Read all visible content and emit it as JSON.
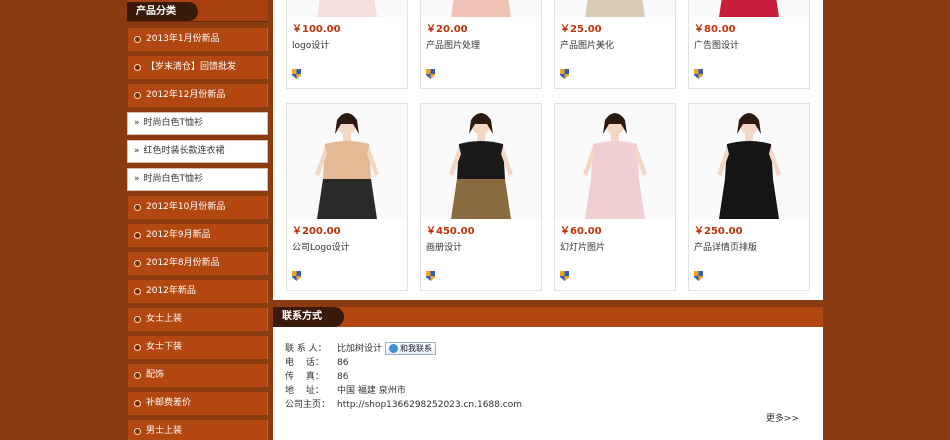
{
  "sidebar": {
    "title": "产品分类",
    "items": [
      {
        "label": "2013年1月份新品",
        "type": "main"
      },
      {
        "label": "【岁末清仓】回馈批发",
        "type": "main"
      },
      {
        "label": "2012年12月份新品",
        "type": "main"
      },
      {
        "label": "时尚白色T恤衫",
        "type": "sub"
      },
      {
        "label": "红色时装长款连衣裙",
        "type": "sub"
      },
      {
        "label": "时尚白色T恤衫",
        "type": "sub"
      },
      {
        "label": "2012年10月份新品",
        "type": "main"
      },
      {
        "label": "2012年9月新品",
        "type": "main"
      },
      {
        "label": "2012年8月份新品",
        "type": "main"
      },
      {
        "label": "2012年新品",
        "type": "main"
      },
      {
        "label": "女士上装",
        "type": "main"
      },
      {
        "label": "女士下装",
        "type": "main"
      },
      {
        "label": "配饰",
        "type": "main"
      },
      {
        "label": "补邮费差价",
        "type": "main"
      },
      {
        "label": "男士上装",
        "type": "main"
      }
    ]
  },
  "products": [
    {
      "price": "￥100.00",
      "title": "logo设计",
      "top_color": "#222222",
      "skirt_color": "#f4dede"
    },
    {
      "price": "￥20.00",
      "title": "产品图片处理",
      "top_color": "#f0c2b6",
      "skirt_color": "#f0c2b6"
    },
    {
      "price": "￥25.00",
      "title": "产品图片美化",
      "top_color": "#efe6d8",
      "skirt_color": "#d9cbb6"
    },
    {
      "price": "￥80.00",
      "title": "广告图设计",
      "top_color": "#c81e3c",
      "skirt_color": "#c81e3c"
    },
    {
      "price": "￥200.00",
      "title": "公司Logo设计",
      "top_color": "#e3b996",
      "skirt_color": "#2a2a2a"
    },
    {
      "price": "￥450.00",
      "title": "画册设计",
      "top_color": "#1a1a1a",
      "skirt_color": "#8a6a3f"
    },
    {
      "price": "￥60.00",
      "title": "幻灯片图片",
      "top_color": "#f0cfd2",
      "skirt_color": "#f0cfd2"
    },
    {
      "price": "￥250.00",
      "title": "产品详情页排版",
      "top_color": "#151515",
      "skirt_color": "#151515"
    }
  ],
  "contact": {
    "title": "联系方式",
    "rows": [
      {
        "label": "联 系 人：",
        "value": "比加树设计"
      },
      {
        "label": "电　 话：",
        "value": "86"
      },
      {
        "label": "传　 真：",
        "value": "86"
      },
      {
        "label": "地　 址：",
        "value": "中国 福建 泉州市"
      },
      {
        "label": "公司主页：",
        "value": "http://shop1366298252023.cn.1688.com"
      }
    ],
    "button_label": "和我联系",
    "more_label": "更多>>"
  },
  "colors": {
    "page_bg": "#8a3b12",
    "accent": "#b34711",
    "tab_dark": "#3a1a0b",
    "price": "#c0330a"
  }
}
